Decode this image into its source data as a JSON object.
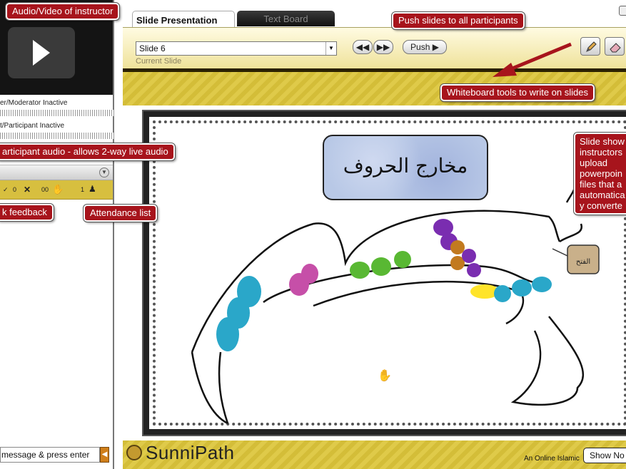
{
  "left_panel": {
    "status_moderator": "er/Moderator Inactive",
    "status_participant": "t/Participant Inactive",
    "controls": {
      "count_x": "0",
      "count_hand": "00",
      "count_attendees": "1"
    },
    "chat_placeholder": "message & press enter"
  },
  "tabs": [
    {
      "label": "Slide Presentation"
    },
    {
      "label": "Text Board"
    }
  ],
  "toolbar": {
    "slide_select": "Slide 6",
    "current_slide_label": "Current Slide",
    "push_label": "Push"
  },
  "slide": {
    "title_arabic": "مخارج الحروف",
    "tag_arabic": "الفتح"
  },
  "footer": {
    "brand": "SunniPath",
    "tagline": "An Online Islamic",
    "show_notes": "Show No"
  },
  "annotations": {
    "audio_video": "Audio/Video of instructor",
    "push_slides": "Push slides to all participants",
    "whiteboard": "Whiteboard tools to write on slides",
    "participant_audio": "articipant audio - allows 2-way live audio",
    "feedback": "k feedback",
    "attendance": "Attendance list",
    "slide_show": "Slide show\ninstructors\nupload\npowerpoin\nfiles that a\nautomatica\ny converte"
  },
  "colors": {
    "callout_bg": "#a7141c",
    "gold": "#dcc53a",
    "toolbar_bg": "#f5ecb0"
  },
  "icons": [
    "play-icon",
    "rewind-icon",
    "fast-forward-icon",
    "pencil-icon",
    "eraser-icon",
    "x-icon",
    "hand-icon",
    "attendee-icon",
    "dropdown-icon",
    "send-icon"
  ]
}
